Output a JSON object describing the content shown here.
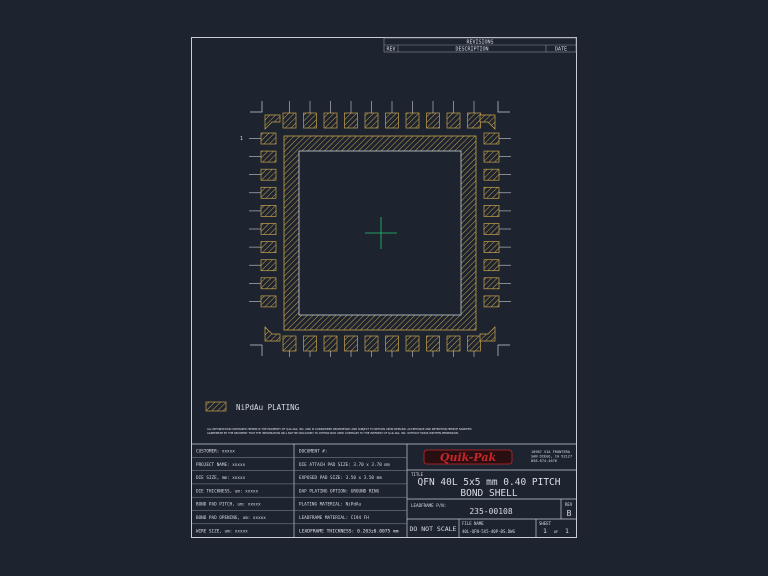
{
  "revisions": {
    "title": "REVISIONS",
    "col_rev": "REV",
    "col_description": "DESCRIPTION",
    "col_date": "DATE"
  },
  "pin1_marker": "1",
  "legend": {
    "label": "NiPdAu PLATING"
  },
  "notice": {
    "line1": "ALL INFORMATION CONTAINED HEREIN IS THE PROPERTY OF Quik-Pak, INC. AND IS CONSIDERED PROPRIETARY AND SUBJECT TO RETURN UPON DEMAND. ACCEPTANCE AND RETENTION HEREOF SIGNIFIES",
    "line2": "AGREEMENT BY THE RECIPIENT THAT THE INFORMATION WILL NOT BE DISCLOSED TO OTHERS NOR USED CONTRARY TO THE INTEREST OF Quik-Pak, INC. WITHOUT PRIOR WRITTEN PERMISSION."
  },
  "fields_left": [
    "CUSTOMER:  xxxxx",
    "PROJECT NAME:  xxxxx",
    "DIE SIZE, mm:  xxxxx",
    "DIE THICKNESS, um:  xxxxx",
    "BOND PAD PITCH, um:  xxxxx",
    "BOND PAD OPENING, um:  xxxxx",
    "WIRE SIZE, um:  xxxxx"
  ],
  "fields_mid": [
    "DOCUMENT #:",
    "DIE ATTACH PAD SIZE:  3.70 x 3.70 mm",
    "EXPOSED PAD SIZE:  3.50 x 3.50 mm",
    "DAP PLATING OPTION:  GROUND RING",
    "PLATING MATERIAL:  NiPdAu",
    "LEADFRAME MATERIAL:  C194 FH",
    "LEADFRAME THICKNESS: 0.203±0.0075 mm"
  ],
  "company": {
    "logo_text": "Quik-Pak",
    "address1": "10987 VIA FRONTERA",
    "address2": "SAN DIEGO, CA 92127",
    "phone": "858-674-4676"
  },
  "title_block": {
    "title_label": "TITLE",
    "title_line1": "QFN 40L 5x5 mm 0.40 PITCH",
    "title_line2": "BOND SHELL",
    "leadframe_label": "LEADFRAME P/N:",
    "leadframe_pn": "235-00108",
    "rev_label": "REV",
    "rev_value": "B",
    "do_not_scale": "DO NOT SCALE",
    "file_label": "FILE NAME",
    "file_name": "40L-QFN-5X5-40P-BS.DWG",
    "sheet_label": "SHEET",
    "sheet_num": "1",
    "sheet_of": "OF",
    "sheet_total": "1"
  },
  "colors": {
    "background": "#1d2430",
    "line": "#c9cdd3",
    "hatch": "#c8a24a",
    "crosshair": "#27c46a",
    "logo_red": "#c8262a"
  }
}
